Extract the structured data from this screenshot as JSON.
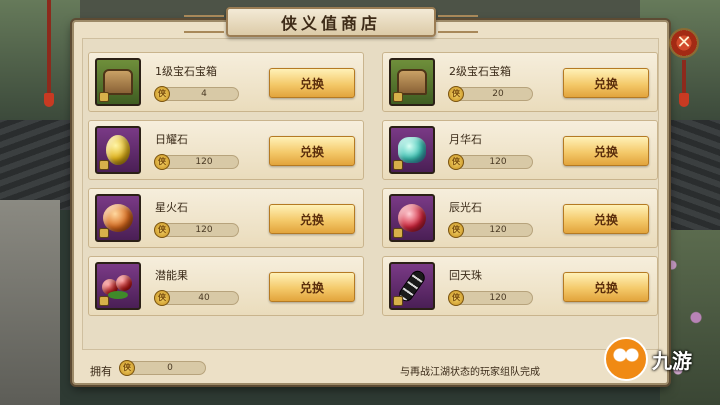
{
  "title": "侠义值商店",
  "close_icon": "✕",
  "items": [
    {
      "name": "1级宝石宝箱",
      "cost": "4",
      "icon": "treasure-chest-icon",
      "frame": "green",
      "button": "兑换"
    },
    {
      "name": "2级宝石宝箱",
      "cost": "20",
      "icon": "treasure-chest-icon",
      "frame": "green",
      "button": "兑换"
    },
    {
      "name": "日耀石",
      "cost": "120",
      "icon": "yellow-gem-icon",
      "frame": "purple",
      "button": "兑换"
    },
    {
      "name": "月华石",
      "cost": "120",
      "icon": "cyan-gem-icon",
      "frame": "purple",
      "button": "兑换"
    },
    {
      "name": "星火石",
      "cost": "120",
      "icon": "orange-gem-icon",
      "frame": "purple",
      "button": "兑换"
    },
    {
      "name": "辰光石",
      "cost": "120",
      "icon": "red-gem-icon",
      "frame": "purple",
      "button": "兑换"
    },
    {
      "name": "潜能果",
      "cost": "40",
      "icon": "red-fruit-icon",
      "frame": "purple",
      "button": "兑换"
    },
    {
      "name": "回天珠",
      "cost": "120",
      "icon": "black-bead-icon",
      "frame": "purple",
      "button": "兑换"
    }
  ],
  "footer": {
    "own_label": "拥有",
    "own_value": "0",
    "hint": "与再战江湖状态的玩家组队完成"
  },
  "watermark": {
    "text": "九游"
  },
  "colors": {
    "panel": "#ece0c6",
    "button": "#f4c96a",
    "frame_green": "#4f7329",
    "frame_purple": "#5e2a6b"
  }
}
